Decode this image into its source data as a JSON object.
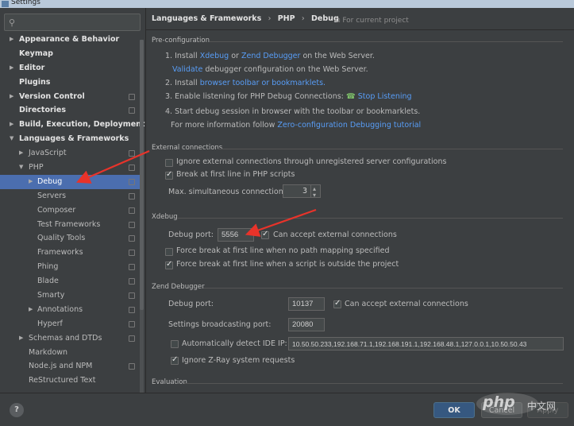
{
  "window": {
    "title": "Settings"
  },
  "sidebar": {
    "search_placeholder": "",
    "items": [
      {
        "label": "Appearance & Behavior",
        "level": 0,
        "arrow": "right",
        "bold": true,
        "cfg": false
      },
      {
        "label": "Keymap",
        "level": 0,
        "arrow": "",
        "bold": true,
        "cfg": false
      },
      {
        "label": "Editor",
        "level": 0,
        "arrow": "right",
        "bold": true,
        "cfg": false
      },
      {
        "label": "Plugins",
        "level": 0,
        "arrow": "",
        "bold": true,
        "cfg": false
      },
      {
        "label": "Version Control",
        "level": 0,
        "arrow": "right",
        "bold": true,
        "cfg": true
      },
      {
        "label": "Directories",
        "level": 0,
        "arrow": "",
        "bold": true,
        "cfg": true
      },
      {
        "label": "Build, Execution, Deployment",
        "level": 0,
        "arrow": "right",
        "bold": true,
        "cfg": false
      },
      {
        "label": "Languages & Frameworks",
        "level": 0,
        "arrow": "down",
        "bold": true,
        "cfg": false
      },
      {
        "label": "JavaScript",
        "level": 1,
        "arrow": "right",
        "bold": false,
        "cfg": true
      },
      {
        "label": "PHP",
        "level": 1,
        "arrow": "down",
        "bold": false,
        "cfg": true
      },
      {
        "label": "Debug",
        "level": 2,
        "arrow": "right",
        "bold": false,
        "cfg": true,
        "selected": true
      },
      {
        "label": "Servers",
        "level": 2,
        "arrow": "",
        "bold": false,
        "cfg": true
      },
      {
        "label": "Composer",
        "level": 2,
        "arrow": "",
        "bold": false,
        "cfg": true
      },
      {
        "label": "Test Frameworks",
        "level": 2,
        "arrow": "",
        "bold": false,
        "cfg": true
      },
      {
        "label": "Quality Tools",
        "level": 2,
        "arrow": "",
        "bold": false,
        "cfg": true
      },
      {
        "label": "Frameworks",
        "level": 2,
        "arrow": "",
        "bold": false,
        "cfg": true
      },
      {
        "label": "Phing",
        "level": 2,
        "arrow": "",
        "bold": false,
        "cfg": true
      },
      {
        "label": "Blade",
        "level": 2,
        "arrow": "",
        "bold": false,
        "cfg": true
      },
      {
        "label": "Smarty",
        "level": 2,
        "arrow": "",
        "bold": false,
        "cfg": true
      },
      {
        "label": "Annotations",
        "level": 2,
        "arrow": "right",
        "bold": false,
        "cfg": true
      },
      {
        "label": "Hyperf",
        "level": 2,
        "arrow": "",
        "bold": false,
        "cfg": true
      },
      {
        "label": "Schemas and DTDs",
        "level": 1,
        "arrow": "right",
        "bold": false,
        "cfg": true
      },
      {
        "label": "Markdown",
        "level": 1,
        "arrow": "",
        "bold": false,
        "cfg": false
      },
      {
        "label": "Node.js and NPM",
        "level": 1,
        "arrow": "",
        "bold": false,
        "cfg": true
      },
      {
        "label": "ReStructured Text",
        "level": 1,
        "arrow": "",
        "bold": false,
        "cfg": false
      }
    ]
  },
  "breadcrumb": {
    "a": "Languages & Frameworks",
    "b": "PHP",
    "c": "Debug",
    "sep": "›"
  },
  "for_current_project": "For current project",
  "preconfig": {
    "heading": "Pre-configuration",
    "s1_prefix": "1. Install",
    "s1_xdebug": "Xdebug",
    "s1_or": "or",
    "s1_zend": "Zend Debugger",
    "s1_suffix": "on the Web Server.",
    "validate_link": "Validate",
    "validate_suffix": "debugger configuration on the Web Server.",
    "s2_prefix": "2. Install",
    "s2_link": "browser toolbar or bookmarklets.",
    "s3_prefix": "3. Enable listening for PHP Debug Connections:",
    "s3_link": "Stop Listening",
    "s4": "4. Start debug session in browser with the toolbar or bookmarklets.",
    "more_prefix": "For more information follow",
    "more_link": "Zero-configuration Debugging tutorial"
  },
  "external": {
    "heading": "External connections",
    "ignore_label": "Ignore external connections through unregistered server configurations",
    "ignore_checked": false,
    "break_label": "Break at first line in PHP scripts",
    "break_checked": true,
    "max_label": "Max. simultaneous connections:",
    "max_value": "3"
  },
  "xdebug": {
    "heading": "Xdebug",
    "port_label": "Debug port:",
    "port_value": "5556",
    "accept_label": "Can accept external connections",
    "accept_checked": true,
    "force_no_path_label": "Force break at first line when no path mapping specified",
    "force_no_path_checked": false,
    "force_outside_label": "Force break at first line when a script is outside the project",
    "force_outside_checked": true
  },
  "zend": {
    "heading": "Zend Debugger",
    "port_label": "Debug port:",
    "port_value": "10137",
    "accept_label": "Can accept external connections",
    "accept_checked": true,
    "broadcast_label": "Settings broadcasting port:",
    "broadcast_value": "20080",
    "detect_label": "Automatically detect IDE IP:",
    "detect_checked": false,
    "ip_value": "10.50.50.233,192.168.71.1,192.168.191.1,192.168.48.1,127.0.0.1,10.50.50.43",
    "zray_label": "Ignore Z-Ray system requests",
    "zray_checked": true
  },
  "evaluation": {
    "heading": "Evaluation"
  },
  "footer": {
    "help": "?",
    "ok": "OK",
    "cancel": "Cancel",
    "apply": "Apply"
  },
  "watermark": {
    "text": "php",
    "suffix": "中文网"
  },
  "colors": {
    "accent": "#4b6eaf",
    "link": "#589df6",
    "arrow": "#e8332a",
    "ok_button": "#365880"
  }
}
